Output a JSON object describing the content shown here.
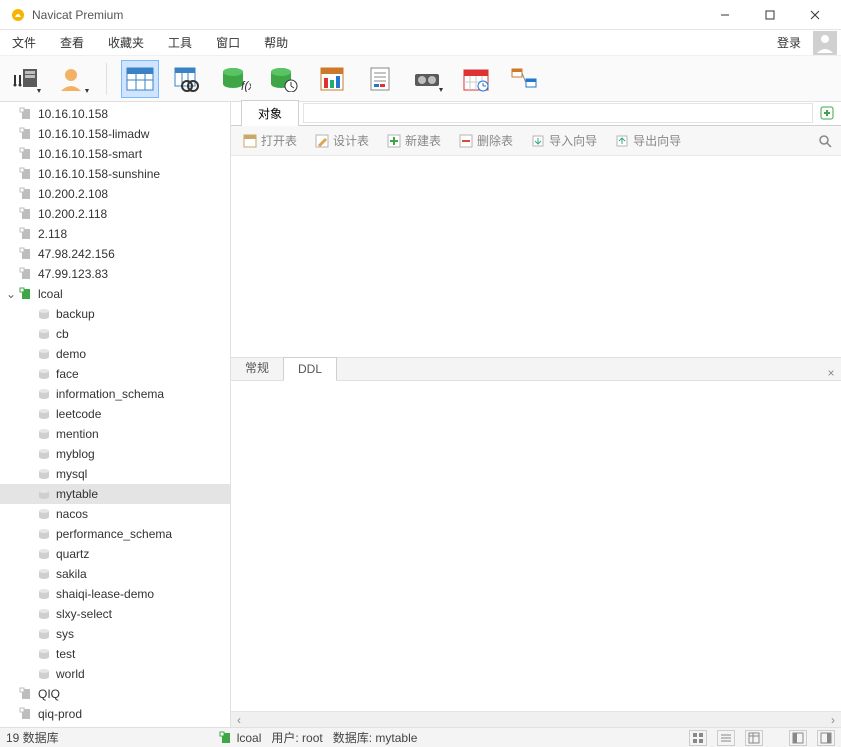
{
  "title": "Navicat Premium",
  "menu": [
    "文件",
    "查看",
    "收藏夹",
    "工具",
    "窗口",
    "帮助"
  ],
  "login_label": "登录",
  "tabs": {
    "object": "对象"
  },
  "actions": {
    "open_table": "打开表",
    "design_table": "设计表",
    "new_table": "新建表",
    "delete_table": "删除表",
    "import_wizard": "导入向导",
    "export_wizard": "导出向导"
  },
  "panel_tabs": {
    "general": "常规",
    "ddl": "DDL"
  },
  "connections": [
    {
      "label": "10.16.10.158",
      "active": false
    },
    {
      "label": "10.16.10.158-limadw",
      "active": false
    },
    {
      "label": "10.16.10.158-smart",
      "active": false
    },
    {
      "label": "10.16.10.158-sunshine",
      "active": false
    },
    {
      "label": "10.200.2.108",
      "active": false
    },
    {
      "label": "10.200.2.118",
      "active": false
    },
    {
      "label": "2.118",
      "active": false
    },
    {
      "label": "47.98.242.156",
      "active": false
    },
    {
      "label": "47.99.123.83",
      "active": false
    },
    {
      "label": "lcoal",
      "active": true,
      "expanded": true
    }
  ],
  "databases": [
    "backup",
    "cb",
    "demo",
    "face",
    "information_schema",
    "leetcode",
    "mention",
    "myblog",
    "mysql",
    "mytable",
    "nacos",
    "performance_schema",
    "quartz",
    "sakila",
    "shaiqi-lease-demo",
    "slxy-select",
    "sys",
    "test",
    "world"
  ],
  "selected_db": "mytable",
  "more_connections": [
    "QIQ",
    "qiq-prod"
  ],
  "status": {
    "count_label": "19 数据库",
    "conn_name": "lcoal",
    "user_label": "用户: root",
    "db_label": "数据库: mytable"
  }
}
